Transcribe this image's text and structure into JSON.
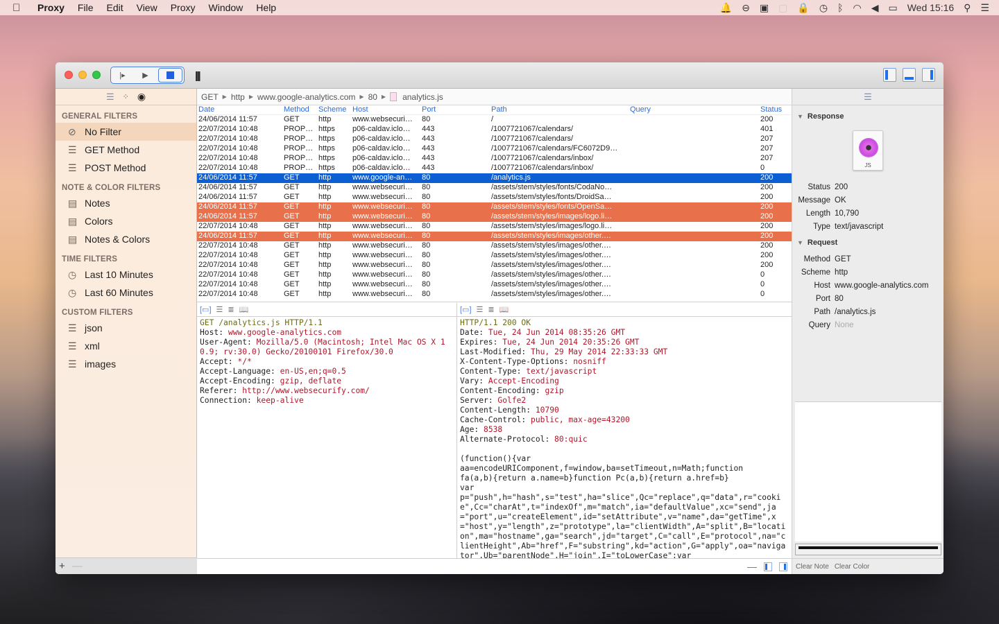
{
  "menubar": {
    "app_name": "Proxy",
    "items": [
      "File",
      "Edit",
      "View",
      "Proxy",
      "Window",
      "Help"
    ],
    "clock": "Wed 15:16",
    "status_icons": [
      "notification-icon",
      "sync-icon",
      "screen-share-icon",
      "blank-icon",
      "lock-icon",
      "time-machine-icon",
      "bluetooth-icon",
      "wifi-icon",
      "volume-icon",
      "battery-icon",
      "spotlight-icon",
      "notification-center-icon"
    ]
  },
  "toolbar": {
    "step_glyph": "|▸",
    "play_glyph": "▶",
    "bars_glyph": "|||"
  },
  "sidebar": {
    "sections": [
      {
        "title": "GENERAL FILTERS",
        "items": [
          {
            "label": "No Filter",
            "icon": "no-filter-icon",
            "glyph": "⊘",
            "selected": true
          },
          {
            "label": "GET Method",
            "icon": "list-icon",
            "glyph": "☰"
          },
          {
            "label": "POST Method",
            "icon": "list-icon",
            "glyph": "☰"
          }
        ]
      },
      {
        "title": "NOTE & COLOR FILTERS",
        "items": [
          {
            "label": "Notes",
            "icon": "notepad-icon",
            "glyph": "▤"
          },
          {
            "label": "Colors",
            "icon": "notepad-icon",
            "glyph": "▤"
          },
          {
            "label": "Notes & Colors",
            "icon": "notepad-icon",
            "glyph": "▤"
          }
        ]
      },
      {
        "title": "TIME FILTERS",
        "items": [
          {
            "label": "Last 10 Minutes",
            "icon": "clock-icon",
            "glyph": "◷"
          },
          {
            "label": "Last 60 Minutes",
            "icon": "clock-icon",
            "glyph": "◷"
          }
        ]
      },
      {
        "title": "CUSTOM FILTERS",
        "items": [
          {
            "label": "json",
            "icon": "list-icon",
            "glyph": "☰"
          },
          {
            "label": "xml",
            "icon": "list-icon",
            "glyph": "☰"
          },
          {
            "label": "images",
            "icon": "list-icon",
            "glyph": "☰"
          }
        ]
      }
    ],
    "add_label": "+",
    "remove_label": "—"
  },
  "breadcrumb": [
    "GET",
    "http",
    "www.google-analytics.com",
    "80",
    "analytics.js"
  ],
  "table": {
    "columns": [
      "Date",
      "Method",
      "Scheme",
      "Host",
      "Port",
      "Path",
      "Query",
      "Status"
    ],
    "rows": [
      {
        "date": "24/06/2014 11:57",
        "method": "GET",
        "scheme": "http",
        "host": "www.websecuri…",
        "port": "80",
        "path": "/",
        "query": "",
        "status": "200",
        "style": ""
      },
      {
        "date": "22/07/2014 10:48",
        "method": "PROP…",
        "scheme": "https",
        "host": "p06-caldav.iclo…",
        "port": "443",
        "path": "/1007721067/calendars/",
        "query": "",
        "status": "401",
        "style": ""
      },
      {
        "date": "22/07/2014 10:48",
        "method": "PROP…",
        "scheme": "https",
        "host": "p06-caldav.iclo…",
        "port": "443",
        "path": "/1007721067/calendars/",
        "query": "",
        "status": "207",
        "style": ""
      },
      {
        "date": "22/07/2014 10:48",
        "method": "PROP…",
        "scheme": "https",
        "host": "p06-caldav.iclo…",
        "port": "443",
        "path": "/1007721067/calendars/FC6072D9…",
        "query": "",
        "status": "207",
        "style": ""
      },
      {
        "date": "22/07/2014 10:48",
        "method": "PROP…",
        "scheme": "https",
        "host": "p06-caldav.iclo…",
        "port": "443",
        "path": "/1007721067/calendars/inbox/",
        "query": "",
        "status": "207",
        "style": ""
      },
      {
        "date": "22/07/2014 10:48",
        "method": "PROP…",
        "scheme": "https",
        "host": "p06-caldav.iclo…",
        "port": "443",
        "path": "/1007721067/calendars/inbox/",
        "query": "",
        "status": "0",
        "style": ""
      },
      {
        "date": "24/06/2014 11:57",
        "method": "GET",
        "scheme": "http",
        "host": "www.google-an…",
        "port": "80",
        "path": "/analytics.js",
        "query": "",
        "status": "200",
        "style": "sel"
      },
      {
        "date": "24/06/2014 11:57",
        "method": "GET",
        "scheme": "http",
        "host": "www.websecuri…",
        "port": "80",
        "path": "/assets/stem/styles/fonts/CodaNo…",
        "query": "",
        "status": "200",
        "style": ""
      },
      {
        "date": "24/06/2014 11:57",
        "method": "GET",
        "scheme": "http",
        "host": "www.websecuri…",
        "port": "80",
        "path": "/assets/stem/styles/fonts/DroidSa…",
        "query": "",
        "status": "200",
        "style": ""
      },
      {
        "date": "24/06/2014 11:57",
        "method": "GET",
        "scheme": "http",
        "host": "www.websecuri…",
        "port": "80",
        "path": "/assets/stem/styles/fonts/OpenSa…",
        "query": "",
        "status": "200",
        "style": "orange"
      },
      {
        "date": "24/06/2014 11:57",
        "method": "GET",
        "scheme": "http",
        "host": "www.websecuri…",
        "port": "80",
        "path": "/assets/stem/styles/images/logo.li…",
        "query": "",
        "status": "200",
        "style": "orange"
      },
      {
        "date": "22/07/2014 10:48",
        "method": "GET",
        "scheme": "http",
        "host": "www.websecuri…",
        "port": "80",
        "path": "/assets/stem/styles/images/logo.li…",
        "query": "",
        "status": "200",
        "style": ""
      },
      {
        "date": "24/06/2014 11:57",
        "method": "GET",
        "scheme": "http",
        "host": "www.websecuri…",
        "port": "80",
        "path": "/assets/stem/styles/images/other.…",
        "query": "",
        "status": "200",
        "style": "orange"
      },
      {
        "date": "22/07/2014 10:48",
        "method": "GET",
        "scheme": "http",
        "host": "www.websecuri…",
        "port": "80",
        "path": "/assets/stem/styles/images/other.…",
        "query": "",
        "status": "200",
        "style": ""
      },
      {
        "date": "22/07/2014 10:48",
        "method": "GET",
        "scheme": "http",
        "host": "www.websecuri…",
        "port": "80",
        "path": "/assets/stem/styles/images/other.…",
        "query": "",
        "status": "200",
        "style": ""
      },
      {
        "date": "22/07/2014 10:48",
        "method": "GET",
        "scheme": "http",
        "host": "www.websecuri…",
        "port": "80",
        "path": "/assets/stem/styles/images/other.…",
        "query": "",
        "status": "200",
        "style": ""
      },
      {
        "date": "22/07/2014 10:48",
        "method": "GET",
        "scheme": "http",
        "host": "www.websecuri…",
        "port": "80",
        "path": "/assets/stem/styles/images/other.…",
        "query": "",
        "status": "0",
        "style": ""
      },
      {
        "date": "22/07/2014 10:48",
        "method": "GET",
        "scheme": "http",
        "host": "www.websecuri…",
        "port": "80",
        "path": "/assets/stem/styles/images/other.…",
        "query": "",
        "status": "0",
        "style": ""
      },
      {
        "date": "22/07/2014 10:48",
        "method": "GET",
        "scheme": "http",
        "host": "www.websecuri…",
        "port": "80",
        "path": "/assets/stem/styles/images/other.…",
        "query": "",
        "status": "0",
        "style": ""
      }
    ]
  },
  "request_pane": {
    "first_line": "GET /analytics.js HTTP/1.1",
    "headers": [
      [
        "Host",
        "www.google-analytics.com"
      ],
      [
        "User-Agent",
        "Mozilla/5.0 (Macintosh; Intel Mac OS X 10.9; rv:30.0) Gecko/20100101 Firefox/30.0"
      ],
      [
        "Accept",
        "*/*"
      ],
      [
        "Accept-Language",
        "en-US,en;q=0.5"
      ],
      [
        "Accept-Encoding",
        "gzip, deflate"
      ],
      [
        "Referer",
        "http://www.websecurify.com/"
      ],
      [
        "Connection",
        "keep-alive"
      ]
    ]
  },
  "response_pane": {
    "first_line": "HTTP/1.1 200 OK",
    "headers": [
      [
        "Date",
        "Tue, 24 Jun 2014 08:35:26 GMT"
      ],
      [
        "Expires",
        "Tue, 24 Jun 2014 20:35:26 GMT"
      ],
      [
        "Last-Modified",
        "Thu, 29 May 2014 22:33:33 GMT"
      ],
      [
        "X-Content-Type-Options",
        "nosniff"
      ],
      [
        "Content-Type",
        "text/javascript"
      ],
      [
        "Vary",
        "Accept-Encoding"
      ],
      [
        "Content-Encoding",
        "gzip"
      ],
      [
        "Server",
        "Golfe2"
      ],
      [
        "Content-Length",
        "10790"
      ],
      [
        "Cache-Control",
        "public, max-age=43200"
      ],
      [
        "Age",
        "8538"
      ],
      [
        "Alternate-Protocol",
        "80:quic"
      ]
    ],
    "body": "(function(){var\naa=encodeURIComponent,f=window,ba=setTimeout,n=Math;function\nfa(a,b){return a.name=b}function Pc(a,b){return a.href=b}\nvar\np=\"push\",h=\"hash\",s=\"test\",ha=\"slice\",Qc=\"replace\",q=\"data\",r=\"cookie\",Cc=\"charAt\",t=\"indexOf\",m=\"match\",ia=\"defaultValue\",xc=\"send\",ja=\"port\",u=\"createElement\",id=\"setAttribute\",v=\"name\",da=\"getTime\",x=\"host\",y=\"length\",z=\"prototype\",la=\"clientWidth\",A=\"split\",B=\"location\",ma=\"hostname\",ga=\"search\",jd=\"target\",C=\"call\",E=\"protocol\",na=\"clientHeight\",Ab=\"href\",F=\"substring\",kd=\"action\",G=\"apply\",oa=\"navigator\",Ub=\"parentNode\",H=\"join\",I=\"toLowerCase\";var"
  },
  "inspector": {
    "response_title": "Response",
    "file_ext": "JS",
    "response": [
      [
        "Status",
        "200"
      ],
      [
        "Message",
        "OK"
      ],
      [
        "Length",
        "10,790"
      ],
      [
        "Type",
        "text/javascript"
      ]
    ],
    "request_title": "Request",
    "request": [
      [
        "Method",
        "GET"
      ],
      [
        "Scheme",
        "http"
      ],
      [
        "Host",
        "www.google-analytics.com"
      ],
      [
        "Port",
        "80"
      ],
      [
        "Path",
        "/analytics.js"
      ],
      [
        "Query",
        "None"
      ]
    ],
    "clear_note": "Clear Note",
    "clear_color": "Clear Color"
  },
  "colors": {
    "selection": "#0b5fd3",
    "highlight": "#e8704a",
    "header_link": "#2f6bd7",
    "code_value": "#b0162a"
  }
}
